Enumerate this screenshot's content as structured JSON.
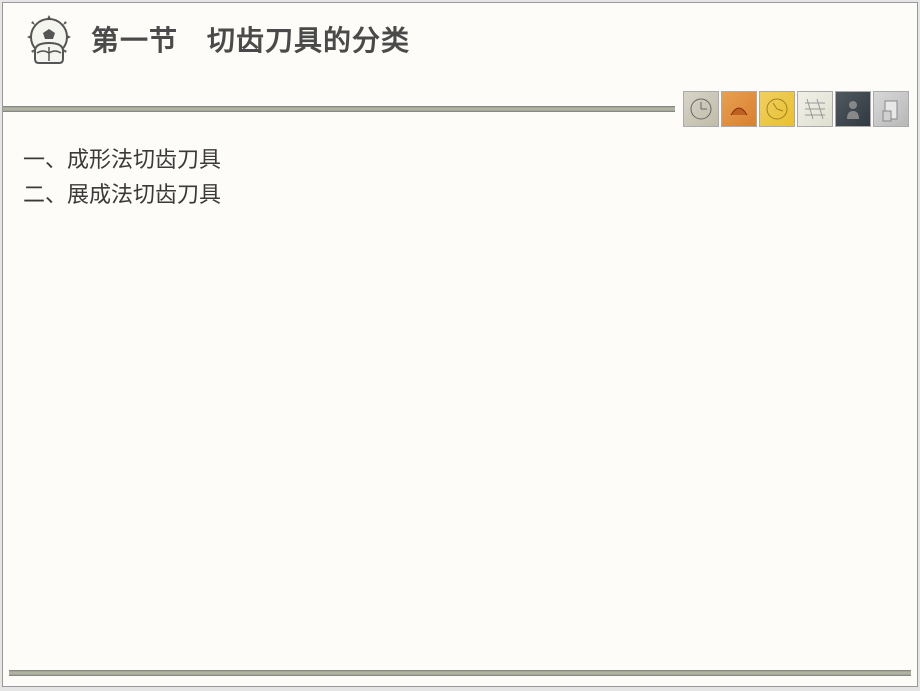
{
  "title": "第一节　切齿刀具的分类",
  "content": {
    "items": [
      "一、成形法切齿刀具",
      "二、展成法切齿刀具"
    ]
  }
}
